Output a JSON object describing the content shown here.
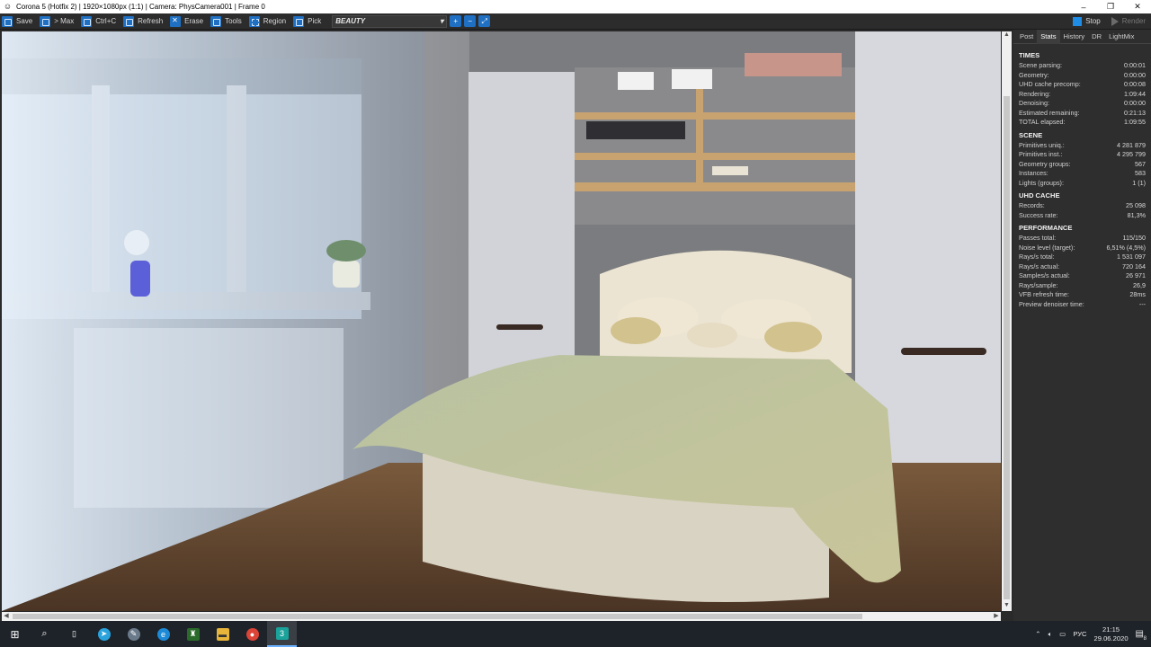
{
  "window": {
    "title": "Corona 5 (Hotfix 2) | 1920×1080px (1:1) | Camera: PhysCamera001 | Frame 0",
    "controls": {
      "minimize": "–",
      "restore": "❐",
      "close": "✕"
    }
  },
  "toolbar": {
    "save": "Save",
    "max": "> Max",
    "copy": "Ctrl+C",
    "refresh": "Refresh",
    "erase": "Erase",
    "tools": "Tools",
    "region": "Region",
    "pick": "Pick",
    "channel": "BEAUTY",
    "stop": "Stop",
    "render": "Render"
  },
  "side_panel": {
    "tabs": [
      "Post",
      "Stats",
      "History",
      "DR",
      "LightMix"
    ],
    "active_tab": "Stats",
    "sections": [
      {
        "title": "TIMES",
        "rows": [
          {
            "label": "Scene parsing:",
            "value": "0:00:01"
          },
          {
            "label": "Geometry:",
            "value": "0:00:00"
          },
          {
            "label": "UHD cache precomp:",
            "value": "0:00:08"
          },
          {
            "label": "Rendering:",
            "value": "1:09:44"
          },
          {
            "label": "Denoising:",
            "value": "0:00:00"
          },
          {
            "label": "Estimated remaining:",
            "value": "0:21:13"
          },
          {
            "label": "TOTAL elapsed:",
            "value": "1:09:55"
          }
        ]
      },
      {
        "title": "SCENE",
        "rows": [
          {
            "label": "Primitives uniq.:",
            "value": "4 281 879"
          },
          {
            "label": "Primitives inst.:",
            "value": "4 295 799"
          },
          {
            "label": "Geometry groups:",
            "value": "567"
          },
          {
            "label": "Instances:",
            "value": "583"
          },
          {
            "label": "Lights (groups):",
            "value": "1 (1)"
          }
        ]
      },
      {
        "title": "UHD CACHE",
        "rows": [
          {
            "label": "Records:",
            "value": "25 098"
          },
          {
            "label": "Success rate:",
            "value": "81,3%"
          }
        ]
      },
      {
        "title": "PERFORMANCE",
        "rows": [
          {
            "label": "Passes total:",
            "value": "115/150"
          },
          {
            "label": "Noise level (target):",
            "value": "6,51% (4,5%)"
          },
          {
            "label": "Rays/s total:",
            "value": "1 531 097"
          },
          {
            "label": "Rays/s actual:",
            "value": "720 164"
          },
          {
            "label": "Samples/s actual:",
            "value": "26 971"
          },
          {
            "label": "Rays/sample:",
            "value": "26,9"
          },
          {
            "label": "VFB refresh time:",
            "value": "28ms"
          },
          {
            "label": "Preview denoiser time:",
            "value": "---"
          }
        ]
      }
    ]
  },
  "taskbar": {
    "apps": [
      "start-icon",
      "search-icon",
      "task-view-icon",
      "telegram-icon",
      "app-icon",
      "edge-icon",
      "security-icon",
      "file-explorer-icon",
      "chrome-icon",
      "3dsmax-icon"
    ],
    "lang": "РУС",
    "time": "21:15",
    "date": "29.06.2020",
    "notifications": "8"
  }
}
